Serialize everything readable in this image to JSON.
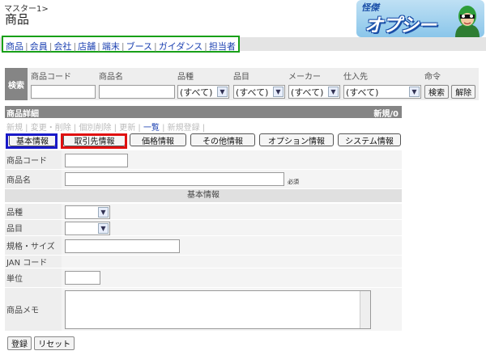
{
  "breadcrumb": "マスター1>",
  "title": "商品",
  "logo": {
    "small": "怪傑",
    "big": "オプシー"
  },
  "nav": [
    "商品",
    "会員",
    "会社",
    "店舗",
    "端末",
    "ブース",
    "ガイダンス",
    "担当者"
  ],
  "search": {
    "label": "検索",
    "columns": [
      {
        "label": "商品コード"
      },
      {
        "label": "商品名"
      },
      {
        "label": "品種",
        "value": "(すべて)"
      },
      {
        "label": "品目",
        "value": "(すべて)"
      },
      {
        "label": "メーカー",
        "value": "(すべて)"
      },
      {
        "label": "仕入先",
        "value": "(すべて)"
      }
    ],
    "command_label": "命令",
    "search_button": "検索",
    "clear_button": "解除"
  },
  "detail": {
    "header": "商品詳細",
    "status": "新規/0",
    "modes": [
      "新規",
      "変更・削除",
      "個別削除",
      "更新",
      "一覧",
      "新規登録"
    ],
    "active_mode": "一覧",
    "tabs": [
      "基本情報",
      "取引先情報",
      "価格情報",
      "その他情報",
      "オプション情報",
      "システム情報"
    ],
    "fields": {
      "code": "商品コード",
      "name": "商品名",
      "required": "必須",
      "section": "基本情報",
      "kind": "品種",
      "item": "品目",
      "spec": "規格・サイズ",
      "jan": "JAN コード",
      "unit": "単位",
      "memo": "商品メモ"
    }
  },
  "buttons": {
    "save": "登録",
    "reset": "リセット"
  },
  "colors": {
    "nav_highlight": "#18a018",
    "tab_blue": "#1a1ac8",
    "tab_red": "#e01010"
  }
}
